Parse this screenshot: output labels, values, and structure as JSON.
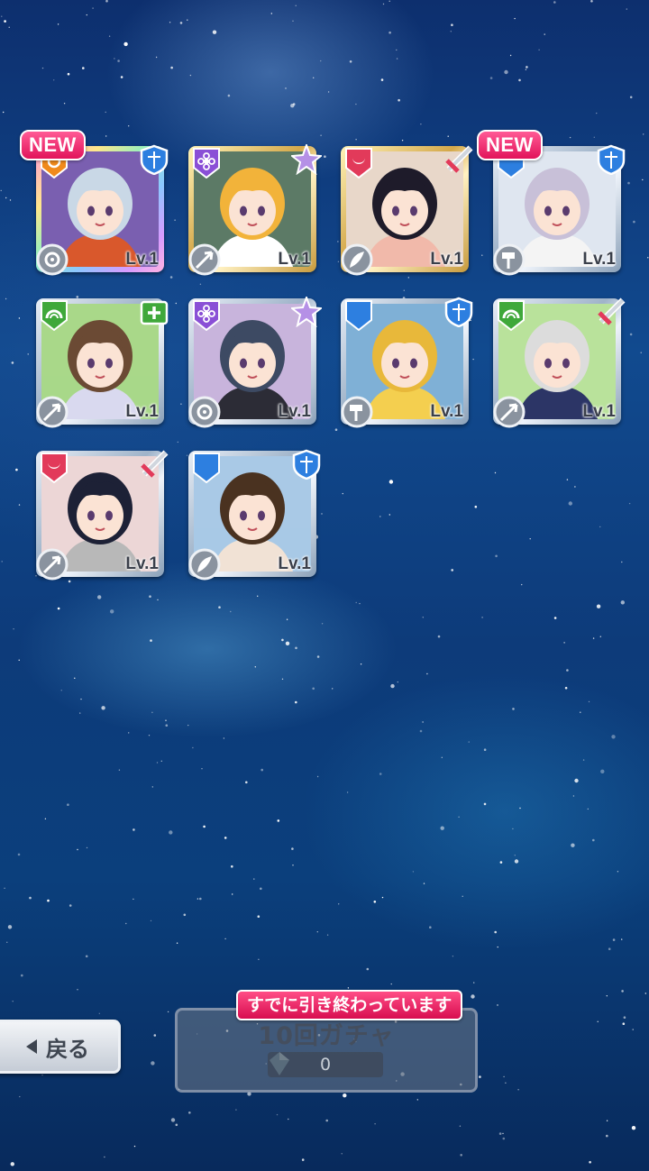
{
  "cards": [
    {
      "new": "NEW",
      "level": "Lv.1",
      "attribute": "sun-orange-icon",
      "role": "shield-blue-icon",
      "skill": "gear-skill-icon",
      "frame": "rainbow",
      "bg": "#7a5fb0",
      "hair": "#c9d8e6",
      "outfit": "#d9582c"
    },
    {
      "new": "",
      "level": "Lv.1",
      "attribute": "flower-purple-icon",
      "role": "star-purple-icon",
      "skill": "arrow-skill-icon",
      "frame": "gold",
      "bg": "#5c7a66",
      "hair": "#f2b33a",
      "outfit": "#ffffff"
    },
    {
      "new": "",
      "level": "Lv.1",
      "attribute": "moon-red-icon",
      "role": "sword-red-icon",
      "skill": "feather-skill-icon",
      "frame": "gold",
      "bg": "#e8d7c9",
      "hair": "#1e1b2a",
      "outfit": "#f1b9aa"
    },
    {
      "new": "NEW",
      "level": "Lv.1",
      "attribute": "crescent-blue-icon",
      "role": "shield-blue-icon",
      "skill": "hammer-skill-icon",
      "frame": "silver",
      "bg": "#dfe6f0",
      "hair": "#c8c0d8",
      "outfit": "#f4f4f4"
    },
    {
      "new": "",
      "level": "Lv.1",
      "attribute": "leaf-green-icon",
      "role": "heal-green-icon",
      "skill": "arrow-skill-icon",
      "frame": "silver",
      "bg": "#a9d889",
      "hair": "#6b4a34",
      "outfit": "#d9d9ef"
    },
    {
      "new": "",
      "level": "Lv.1",
      "attribute": "flower-purple-icon",
      "role": "star-purple-icon",
      "skill": "gear-skill-icon",
      "frame": "silver",
      "bg": "#c8b4dc",
      "hair": "#3d4a63",
      "outfit": "#2c2c36"
    },
    {
      "new": "",
      "level": "Lv.1",
      "attribute": "crescent-blue-icon",
      "role": "shield-blue-icon",
      "skill": "hammer-skill-icon",
      "frame": "silver",
      "bg": "#7fb0d6",
      "hair": "#e8b83a",
      "outfit": "#f4cf4f"
    },
    {
      "new": "",
      "level": "Lv.1",
      "attribute": "leaf-green-icon",
      "role": "sword-red-icon",
      "skill": "arrow-skill-icon",
      "frame": "silver",
      "bg": "#b9e29b",
      "hair": "#dcdcdc",
      "outfit": "#2c3566"
    },
    {
      "new": "",
      "level": "Lv.1",
      "attribute": "moon-red-icon",
      "role": "sword-red-icon",
      "skill": "arrow-skill-icon",
      "frame": "silver",
      "bg": "#ecd6d6",
      "hair": "#1d2136",
      "outfit": "#b8b8b8"
    },
    {
      "new": "",
      "level": "Lv.1",
      "attribute": "crescent-blue-icon",
      "role": "shield-blue-icon",
      "skill": "feather-skill-icon",
      "frame": "silver",
      "bg": "#a9c9e6",
      "hair": "#4a3220",
      "outfit": "#f1e2d5"
    }
  ],
  "back_button": {
    "label": "戻る"
  },
  "gacha_button": {
    "label": "10回ガチャ",
    "cost": "0",
    "status_badge": "すでに引き終わっています"
  },
  "colors": {
    "accent_pink": "#e2145a",
    "attr_red": "#e23a5a",
    "attr_purple": "#8a4fd6",
    "attr_blue": "#2d7fe0",
    "attr_green": "#3fa83a",
    "attr_orange": "#f08a1c"
  }
}
